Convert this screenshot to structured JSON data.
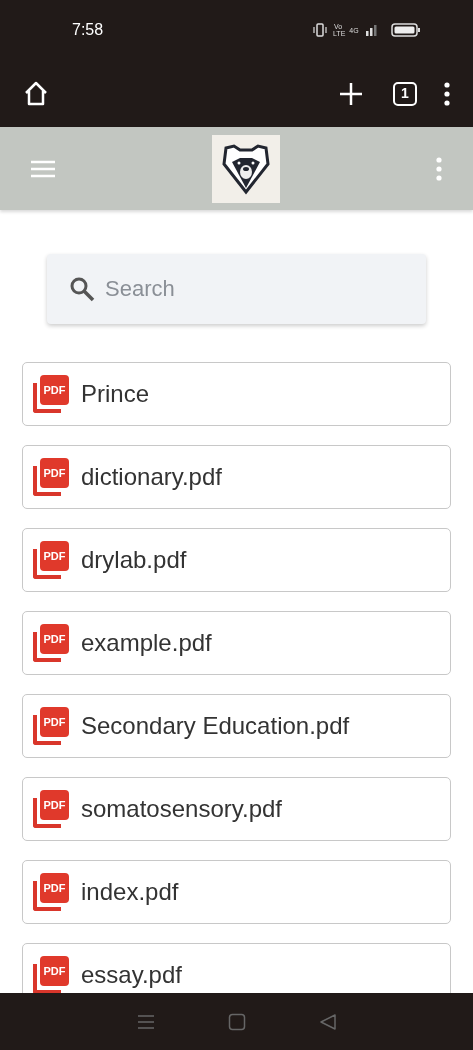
{
  "status_bar": {
    "time": "7:58",
    "volte": "Vo LTE",
    "network": "4G"
  },
  "browser_toolbar": {
    "tab_count": "1"
  },
  "search": {
    "placeholder": "Search"
  },
  "files": [
    {
      "name": "Prince",
      "icon_label": "PDF"
    },
    {
      "name": "dictionary.pdf",
      "icon_label": "PDF"
    },
    {
      "name": "drylab.pdf",
      "icon_label": "PDF"
    },
    {
      "name": "example.pdf",
      "icon_label": "PDF"
    },
    {
      "name": "Secondary Education.pdf",
      "icon_label": "PDF"
    },
    {
      "name": "somatosensory.pdf",
      "icon_label": "PDF"
    },
    {
      "name": "index.pdf",
      "icon_label": "PDF"
    },
    {
      "name": "essay.pdf",
      "icon_label": "PDF"
    }
  ]
}
